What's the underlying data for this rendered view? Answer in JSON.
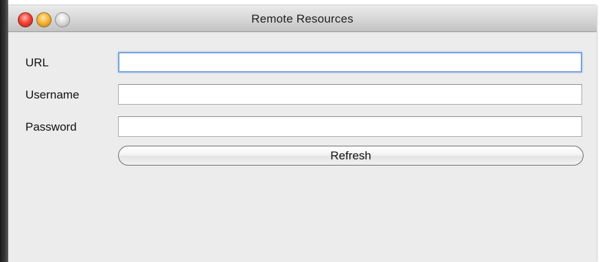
{
  "window": {
    "title": "Remote Resources"
  },
  "form": {
    "url_label": "URL",
    "url_value": "",
    "username_label": "Username",
    "username_value": "",
    "password_label": "Password",
    "password_value": ""
  },
  "actions": {
    "refresh_label": "Refresh"
  },
  "colors": {
    "close": "#f2453a",
    "minimize": "#f5b63b",
    "zoom": "#c8c8c8",
    "focus_ring": "#7aa4d9",
    "window_bg": "#ececec"
  }
}
